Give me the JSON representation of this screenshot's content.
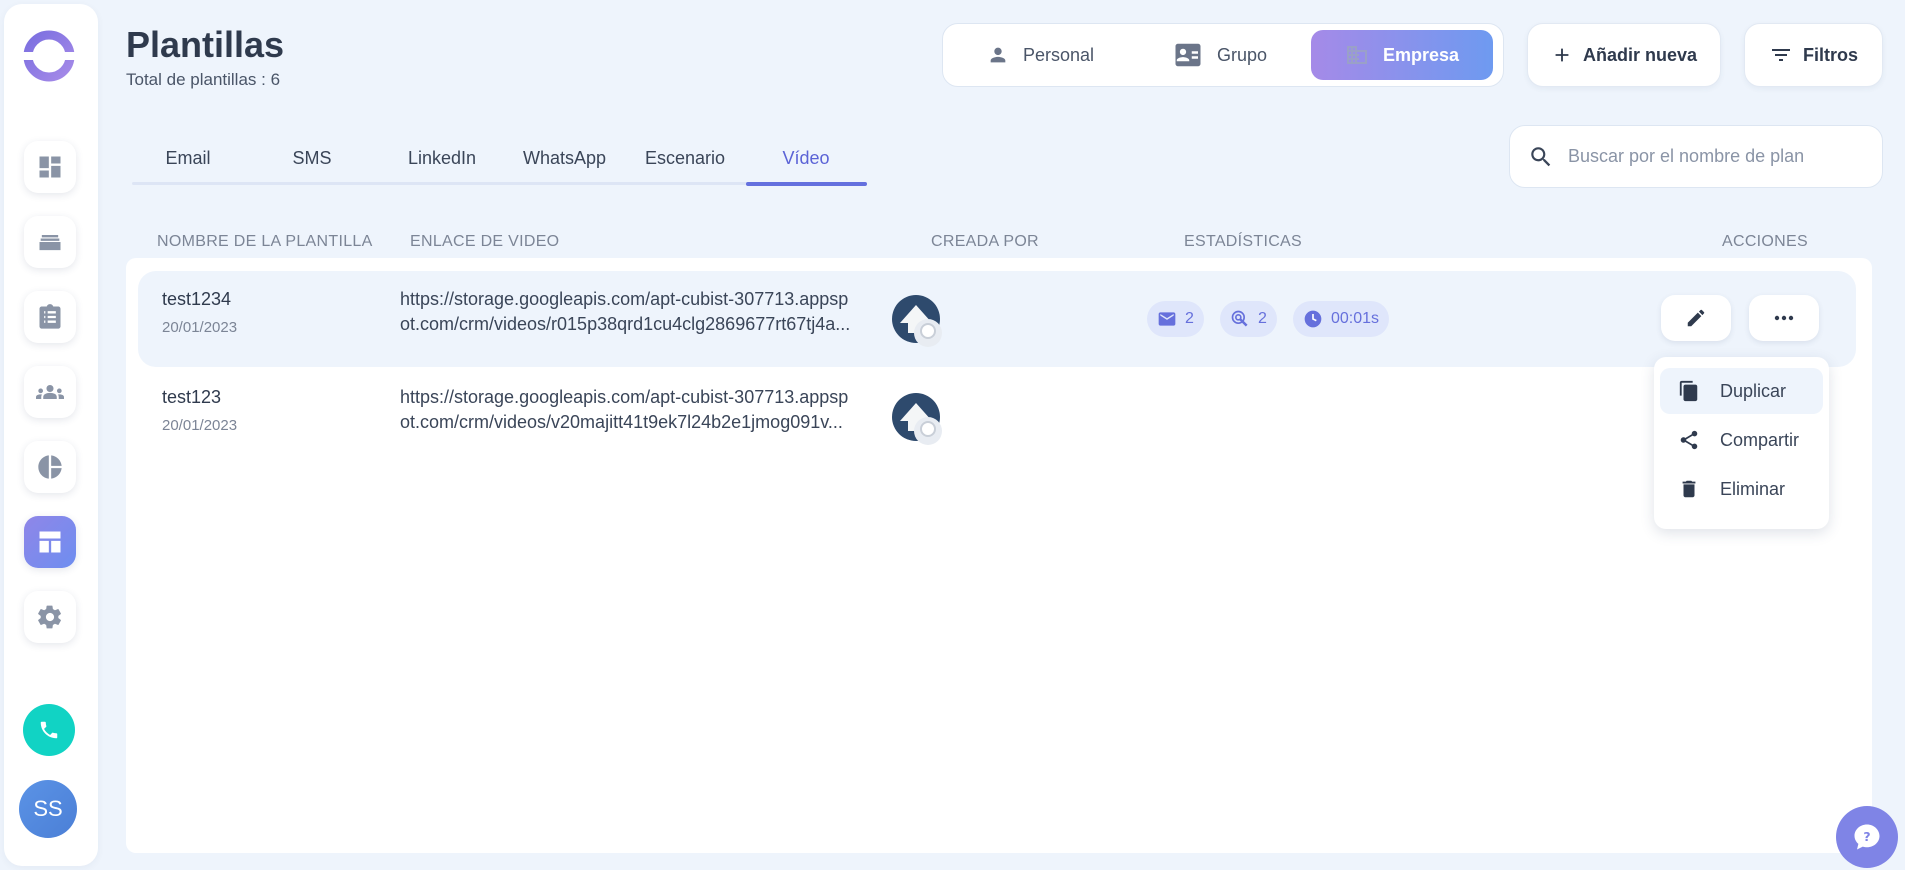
{
  "header": {
    "title": "Plantillas",
    "subtitle": "Total de plantillas : 6"
  },
  "scope": {
    "items": [
      {
        "label": "Personal",
        "icon": "person-icon"
      },
      {
        "label": "Grupo",
        "icon": "contact-card-icon"
      },
      {
        "label": "Empresa",
        "icon": "building-icon",
        "active": true
      }
    ]
  },
  "toolbar": {
    "add_label": "Añadir nueva",
    "filters_label": "Filtros"
  },
  "tabs": [
    {
      "label": "Email"
    },
    {
      "label": "SMS"
    },
    {
      "label": "LinkedIn"
    },
    {
      "label": "WhatsApp"
    },
    {
      "label": "Escenario"
    },
    {
      "label": "Vídeo",
      "active": true
    }
  ],
  "search": {
    "placeholder": "Buscar por el nombre de plan",
    "value": ""
  },
  "table": {
    "columns": [
      "NOMBRE DE LA PLANTILLA",
      "ENLACE DE VIDEO",
      "CREADA POR",
      "ESTADÍSTICAS",
      "ACCIONES"
    ],
    "rows": [
      {
        "name": "test1234",
        "date": "20/01/2023",
        "link_line1": "https://storage.googleapis.com/apt-cubist-307713.appsp",
        "link_line2": "ot.com/crm/videos/r015p38qrd1cu4clg2869677rt67tj4a...",
        "stats": {
          "emails": "2",
          "clicks": "2",
          "time": "00:01s"
        }
      },
      {
        "name": "test123",
        "date": "20/01/2023",
        "link_line1": "https://storage.googleapis.com/apt-cubist-307713.appsp",
        "link_line2": "ot.com/crm/videos/v20majitt41t9ek7l24b2e1jmog091v..."
      }
    ]
  },
  "dropdown": {
    "items": [
      {
        "label": "Duplicar",
        "icon": "copy-icon"
      },
      {
        "label": "Compartir",
        "icon": "share-icon"
      },
      {
        "label": "Eliminar",
        "icon": "trash-icon"
      }
    ]
  },
  "user": {
    "initials": "SS"
  },
  "colors": {
    "accent": "#6470de",
    "background": "#eef4fc",
    "phone": "#11d3c4",
    "stat_chip": "#dfe6fb"
  }
}
